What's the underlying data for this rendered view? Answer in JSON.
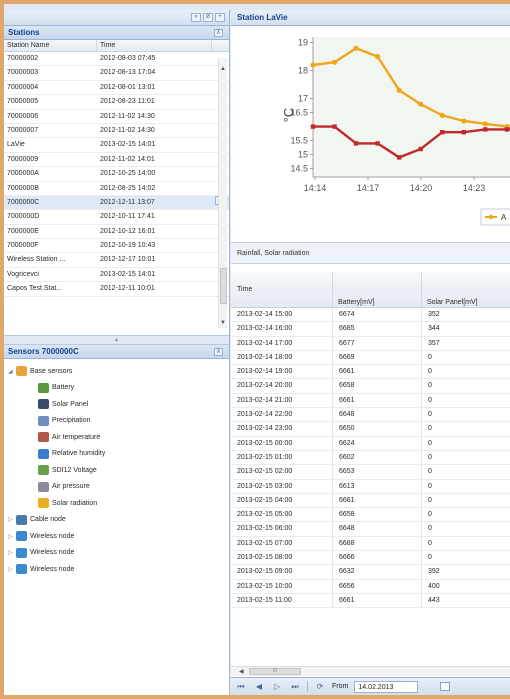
{
  "toolbar": {
    "btn1": "«",
    "btn2": "⊘",
    "btn3": "+"
  },
  "stations": {
    "title": "Stations",
    "collapse_icon": "⊼",
    "columns": [
      "Station Name",
      "Time"
    ],
    "rows": [
      {
        "name": "70000002",
        "time": "2012-08-03 07:45"
      },
      {
        "name": "70000003",
        "time": "2012-08-13 17:04"
      },
      {
        "name": "70000004",
        "time": "2012-08-01 13:01"
      },
      {
        "name": "70000005",
        "time": "2012-08-23 11:01"
      },
      {
        "name": "70000006",
        "time": "2012-11-02 14:30"
      },
      {
        "name": "70000007",
        "time": "2012-11-02 14:30"
      },
      {
        "name": "LaVie",
        "time": "2013-02-15 14:01"
      },
      {
        "name": "70000009",
        "time": "2012-11-02 14:01"
      },
      {
        "name": "7000000A",
        "time": "2012-10-25 14:00"
      },
      {
        "name": "7000000B",
        "time": "2012-08-25 14:02"
      },
      {
        "name": "7000000C",
        "time": "2012-12-11 13:07"
      },
      {
        "name": "7000000D",
        "time": "2012-10-11 17:41"
      },
      {
        "name": "7000000E",
        "time": "2012-10-12 16:01"
      },
      {
        "name": "7000000F",
        "time": "2012-10-19 10:43"
      },
      {
        "name": "Wireless Station ...",
        "time": "2012-12-17 10:01"
      },
      {
        "name": "Vogricevci",
        "time": "2013-02-15 14:01"
      },
      {
        "name": "Capos Test Stat...",
        "time": "2012-12-11 10:01"
      }
    ],
    "selected_index": 10
  },
  "sensors": {
    "title": "Sensors 7000000C",
    "tree": [
      {
        "label": "Base sensors",
        "icon": "home-icon",
        "level": 0,
        "twisty": "◢",
        "color": "#e8a33a"
      },
      {
        "label": "Battery",
        "icon": "battery-icon",
        "level": 1,
        "twisty": "",
        "color": "#5a9a3c"
      },
      {
        "label": "Solar Panel",
        "icon": "solar-panel-icon",
        "level": 1,
        "twisty": "",
        "color": "#3a4a6a"
      },
      {
        "label": "Precipitation",
        "icon": "cloud-icon",
        "level": 1,
        "twisty": "",
        "color": "#6f8fbf"
      },
      {
        "label": "Air temperature",
        "icon": "thermometer-icon",
        "level": 1,
        "twisty": "",
        "color": "#b0584a"
      },
      {
        "label": "Relative humidity",
        "icon": "humidity-icon",
        "level": 1,
        "twisty": "",
        "color": "#3b7bd0"
      },
      {
        "label": "SDI12 Voltage",
        "icon": "voltage-icon",
        "level": 1,
        "twisty": "",
        "color": "#6aa04a"
      },
      {
        "label": "Air pressure",
        "icon": "pressure-icon",
        "level": 1,
        "twisty": "",
        "color": "#8a8a9a"
      },
      {
        "label": "Solar radiation",
        "icon": "sun-icon",
        "level": 1,
        "twisty": "",
        "color": "#e8b020"
      },
      {
        "label": "Cable node",
        "icon": "cable-node-icon",
        "level": 0,
        "twisty": "▷",
        "color": "#4a7ab0"
      },
      {
        "label": "Wireless node",
        "icon": "wireless-icon",
        "level": 0,
        "twisty": "▷",
        "color": "#3a8ad0"
      },
      {
        "label": "Wireless node",
        "icon": "wireless-icon",
        "level": 0,
        "twisty": "▷",
        "color": "#3a8ad0"
      },
      {
        "label": "Wireless node",
        "icon": "wireless-icon",
        "level": 0,
        "twisty": "▷",
        "color": "#3a8ad0"
      }
    ]
  },
  "station_panel": {
    "title": "Station LaVie"
  },
  "chart_data": {
    "type": "line",
    "ylabel": "°C",
    "yticks": [
      "14.5",
      "15",
      "15.5",
      "16.5",
      "17",
      "18",
      "19"
    ],
    "xticks": [
      "14:14",
      "14:17",
      "14:20",
      "14:23"
    ],
    "x": [
      0,
      1,
      2,
      3,
      4,
      5,
      6,
      7,
      8,
      9,
      10,
      11
    ],
    "series": [
      {
        "name": "A",
        "color": "#f2a51c",
        "values": [
          18.2,
          18.3,
          18.8,
          18.5,
          17.3,
          16.8,
          16.4,
          16.2,
          16.1,
          16.0,
          16.0,
          16.0
        ]
      },
      {
        "name": "",
        "color": "#c0282a",
        "values": [
          16.0,
          16.0,
          15.4,
          15.4,
          14.9,
          15.2,
          15.8,
          15.8,
          15.9,
          15.9,
          15.9,
          15.9
        ]
      }
    ],
    "legend_item": "A"
  },
  "rain_section": {
    "title": "Rainfall, Solar radiation"
  },
  "data_grid": {
    "columns": {
      "time": "Time",
      "battery": "Battery[mV]",
      "solar": "Solar Panel[mV]"
    },
    "rows": [
      {
        "time": "2013-02-14 15:00",
        "battery": "6674",
        "solar": "352"
      },
      {
        "time": "2013-02-14 16:00",
        "battery": "6685",
        "solar": "344"
      },
      {
        "time": "2013-02-14 17:00",
        "battery": "6677",
        "solar": "357"
      },
      {
        "time": "2013-02-14 18:00",
        "battery": "6669",
        "solar": "0"
      },
      {
        "time": "2013-02-14 19:00",
        "battery": "6661",
        "solar": "0"
      },
      {
        "time": "2013-02-14 20:00",
        "battery": "6658",
        "solar": "0"
      },
      {
        "time": "2013-02-14 21:00",
        "battery": "6661",
        "solar": "0"
      },
      {
        "time": "2013-02-14 22:00",
        "battery": "6648",
        "solar": "0"
      },
      {
        "time": "2013-02-14 23:00",
        "battery": "6650",
        "solar": "0"
      },
      {
        "time": "2013-02-15 00:00",
        "battery": "6624",
        "solar": "0"
      },
      {
        "time": "2013-02-15 01:00",
        "battery": "6602",
        "solar": "0"
      },
      {
        "time": "2013-02-15 02:00",
        "battery": "6653",
        "solar": "0"
      },
      {
        "time": "2013-02-15 03:00",
        "battery": "6613",
        "solar": "0"
      },
      {
        "time": "2013-02-15 04:00",
        "battery": "6661",
        "solar": "0"
      },
      {
        "time": "2013-02-15 05:00",
        "battery": "6658",
        "solar": "0"
      },
      {
        "time": "2013-02-15 06:00",
        "battery": "6648",
        "solar": "0"
      },
      {
        "time": "2013-02-15 07:00",
        "battery": "6688",
        "solar": "0"
      },
      {
        "time": "2013-02-15 08:00",
        "battery": "6666",
        "solar": "0"
      },
      {
        "time": "2013-02-15 09:00",
        "battery": "6632",
        "solar": "392"
      },
      {
        "time": "2013-02-15 10:00",
        "battery": "6656",
        "solar": "400"
      },
      {
        "time": "2013-02-15 11:00",
        "battery": "6661",
        "solar": "443"
      }
    ]
  },
  "hscroll": {
    "left_arrow": "◀",
    "thumb_grip": "III"
  },
  "pager": {
    "first": "⏮",
    "prev": "◀",
    "next": "▷",
    "last": "⏭",
    "refresh": "⟳",
    "from_label": "From",
    "from_value": "14.02.2013"
  }
}
